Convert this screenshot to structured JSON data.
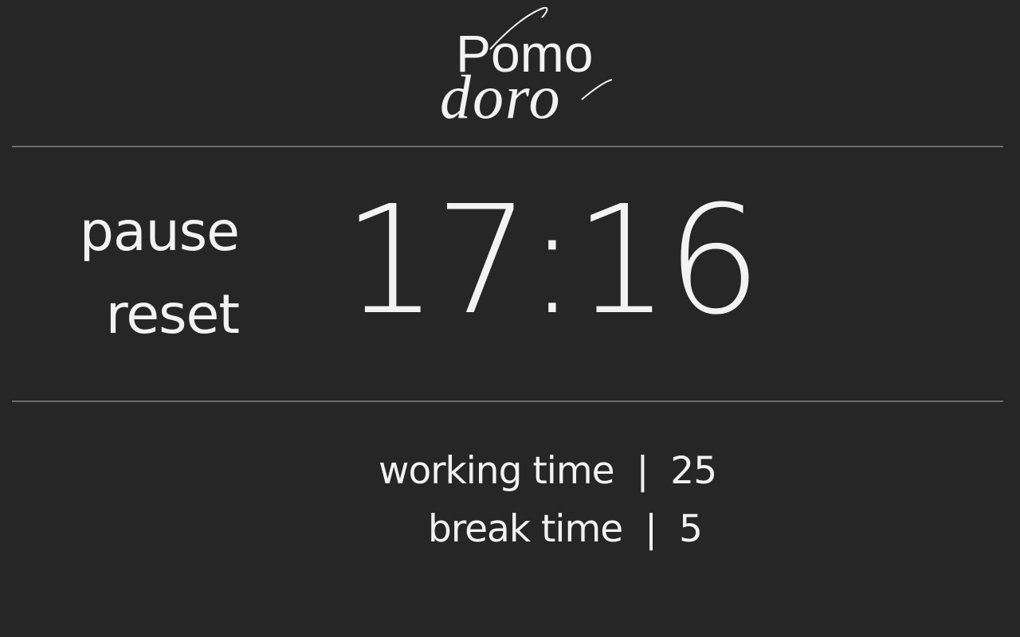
{
  "logo": {
    "line1": "Pomo",
    "line2": "doro"
  },
  "controls": {
    "pause_label": "pause",
    "reset_label": "reset"
  },
  "timer": {
    "display": "17:16"
  },
  "settings": {
    "working_time_label": "working time",
    "working_time_value": "25",
    "break_time_label": "break time",
    "break_time_value": "5",
    "separator": "|"
  },
  "colors": {
    "background": "#262626",
    "text": "#f2f2f2",
    "divider": "#6b6b6b"
  }
}
